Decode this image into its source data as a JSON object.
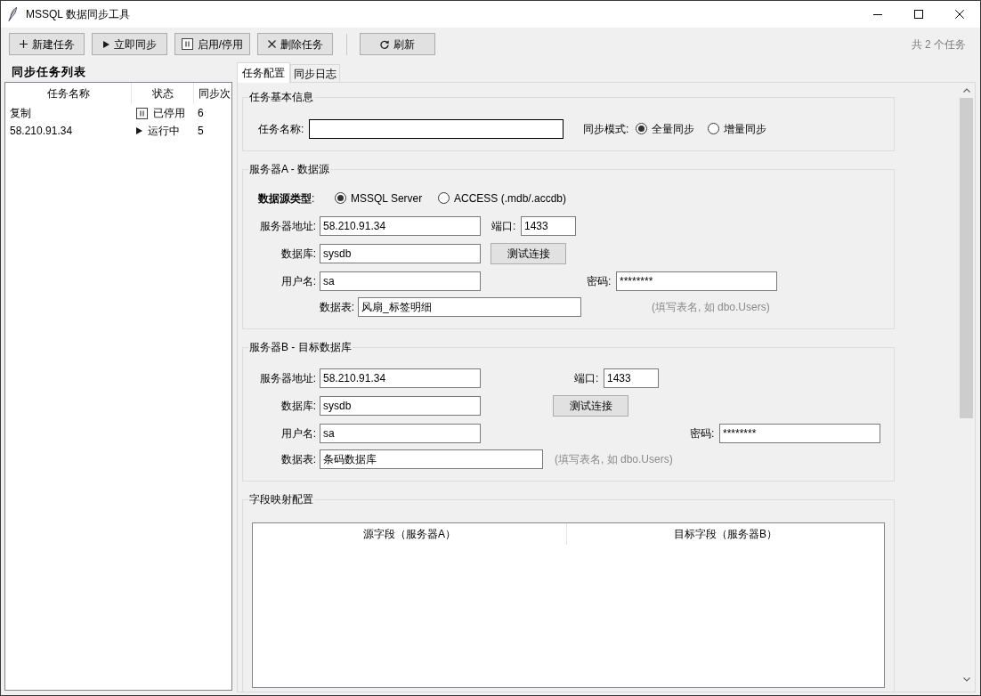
{
  "window": {
    "title": "MSSQL 数据同步工具"
  },
  "toolbar": {
    "groups": [
      [
        {
          "kind": "add",
          "label": "新建任务"
        },
        {
          "kind": "run",
          "label": "立即同步"
        },
        {
          "kind": "toggle",
          "label": "启用/停用"
        },
        {
          "kind": "delete",
          "label": "删除任务"
        }
      ],
      [
        {
          "kind": "refresh",
          "label": "刷新"
        }
      ]
    ],
    "task_count": "共 2 个任务"
  },
  "task_list": {
    "title": "同步任务列表",
    "columns": [
      "任务名称",
      "状态",
      "同步次"
    ],
    "rows": [
      {
        "name": "复制",
        "status": "已停用",
        "running": false,
        "count": "6",
        "selected": false
      },
      {
        "name": "58.210.91.34",
        "status": "运行中",
        "running": true,
        "count": "5",
        "selected": false
      }
    ]
  },
  "tabs": [
    {
      "label": "任务配置",
      "selected": true
    },
    {
      "label": "同步日志",
      "selected": false
    }
  ],
  "basic_info": {
    "title": "任务基本信息",
    "task_name": {
      "label": "任务名称:",
      "focused": true
    },
    "sync_mode": {
      "label": "同步模式:",
      "options": [
        {
          "label": "全量同步",
          "selected": true
        },
        {
          "label": "增量同步",
          "selected": false
        }
      ]
    }
  },
  "server_a": {
    "title": "服务器A - 数据源",
    "source_type": {
      "label": "**数据源类型**:",
      "options": [
        {
          "label": "MSSQL Server",
          "selected": true
        },
        {
          "label": "ACCESS (.mdb/.accdb)",
          "selected": false
        }
      ]
    },
    "address": {
      "label": "服务器地址:",
      "value": "58.210.91.34"
    },
    "port": {
      "label": "端口:",
      "value": "1433"
    },
    "database": {
      "label": "数据库:",
      "value": "sysdb"
    },
    "test_button": "测试连接",
    "username": {
      "label": "用户名:",
      "value": "sa"
    },
    "password": {
      "label": "密码:",
      "value": "********"
    },
    "table": {
      "label": "数据表:",
      "value": "风扇_标签明细"
    },
    "hint": "(填写表名, 如 dbo.Users)"
  },
  "server_b": {
    "title": "服务器B - 目标数据库",
    "address": {
      "label": "服务器地址:",
      "value": "58.210.91.34"
    },
    "port": {
      "label": "端口:",
      "value": "1433"
    },
    "database": {
      "label": "数据库:",
      "value": "sysdb"
    },
    "test_button": "测试连接",
    "username": {
      "label": "用户名:",
      "value": "sa"
    },
    "password": {
      "label": "密码:",
      "value": "********"
    },
    "table": {
      "label": "数据表:",
      "value": "条码数据库"
    },
    "hint": "(填写表名, 如 dbo.Users)"
  },
  "field_mapping": {
    "title": "字段映射配置",
    "columns": [
      "源字段（服务器A）",
      "目标字段（服务器B）"
    ]
  }
}
